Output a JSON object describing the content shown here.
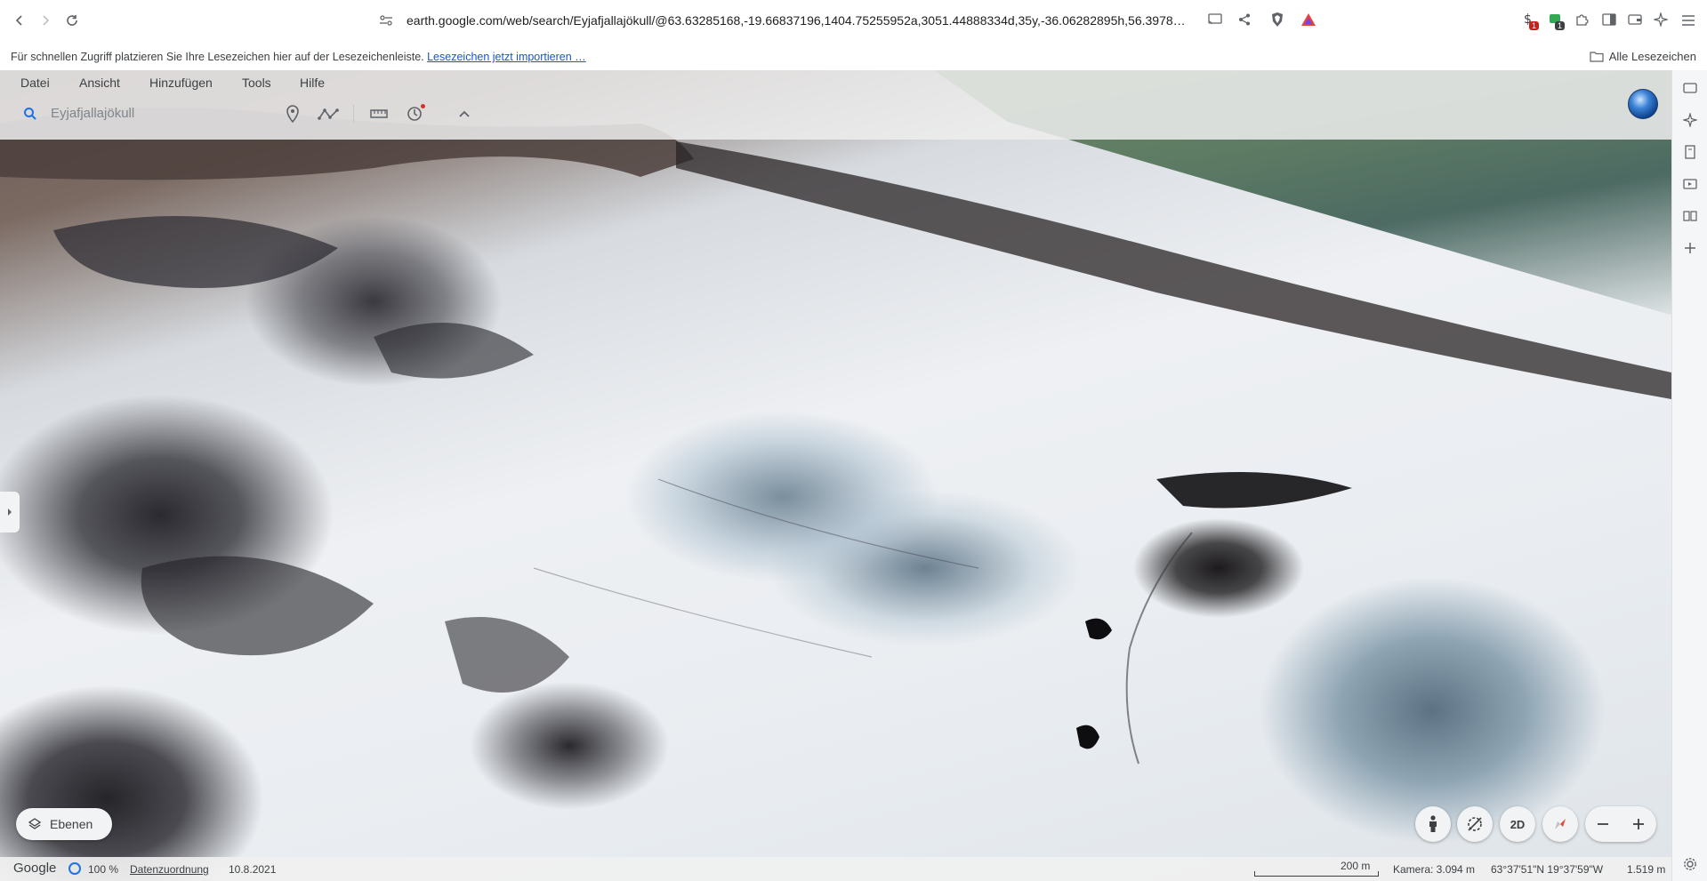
{
  "browser": {
    "url": "earth.google.com/web/search/Eyjafjallajökull/@63.63285168,-19.66837196,1404.75255952a,3051.44888334d,35y,-36.06282895h,56.3978…",
    "extension_badges": [
      "1",
      "1"
    ]
  },
  "bookmarks": {
    "prompt": "Für schnellen Zugriff platzieren Sie Ihre Lesezeichen hier auf der Lesezeichenleiste.",
    "import_link": "Lesezeichen jetzt importieren …",
    "all_bookmarks": "Alle Lesezeichen"
  },
  "earth": {
    "menu": [
      "Datei",
      "Ansicht",
      "Hinzufügen",
      "Tools",
      "Hilfe"
    ],
    "search_value": "Eyjafjallajökull",
    "layers_label": "Ebenen",
    "view_mode": "2D"
  },
  "status": {
    "brand": "Google",
    "load_percent": "100 %",
    "attribution": "Datenzuordnung",
    "date": "10.8.2021",
    "scale": "200 m",
    "camera": "Kamera: 3.094 m",
    "coordinates": "63°37'51\"N 19°37'59\"W",
    "elevation": "1.519 m"
  },
  "colors": {
    "accent": "#1a73e8",
    "link": "#1a56c9"
  }
}
